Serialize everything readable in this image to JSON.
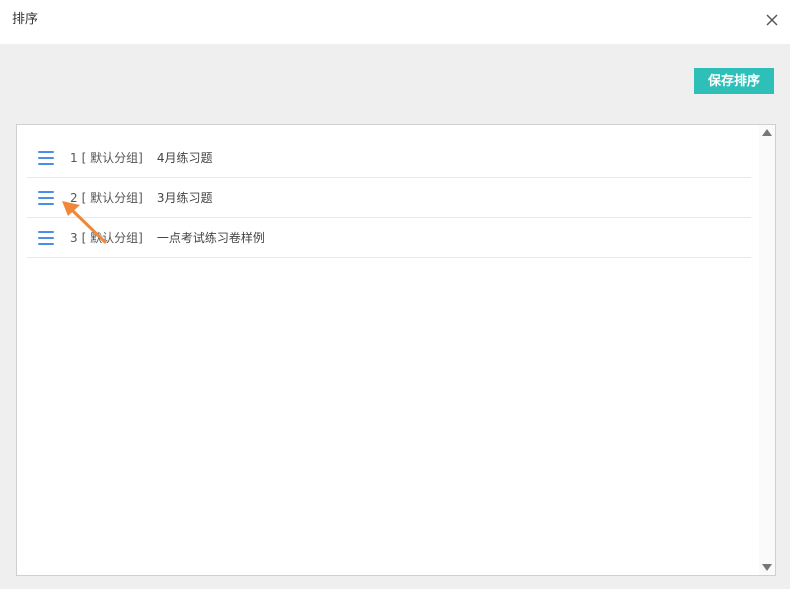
{
  "dialog": {
    "title": "排序",
    "close_icon": "close-icon"
  },
  "toolbar": {
    "save_label": "保存排序"
  },
  "list": {
    "items": [
      {
        "index": "1",
        "group": "[ 默认分组]",
        "name": "4月练习题"
      },
      {
        "index": "2",
        "group": "[ 默认分组]",
        "name": "3月练习题"
      },
      {
        "index": "3",
        "group": "[ 默认分组]",
        "name": "一点考试练习卷样例"
      }
    ]
  },
  "colors": {
    "accent": "#2ebfb8",
    "handle": "#4a90e2",
    "annotation_arrow": "#f0883a"
  }
}
